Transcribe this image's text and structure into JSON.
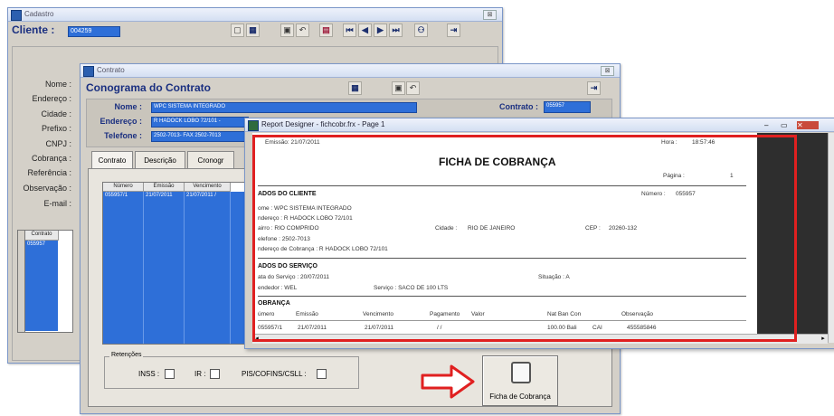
{
  "cadastro": {
    "title": "Cadastro",
    "cliente_label": "Cliente :",
    "cliente_value": "004259",
    "field_labels": [
      "Nome :",
      "Endereço :",
      "Cidade :",
      "Prefixo :",
      "CNPJ :",
      "Cobrança :",
      "Referência :",
      "Observação :",
      "E-mail :"
    ],
    "mini_grid": {
      "header": "Contrato",
      "row": "055957"
    },
    "toolbar_icons": [
      "new-icon",
      "print-icon",
      "save-icon",
      "undo-icon",
      "exit-icon",
      "first-icon",
      "prev-icon",
      "next-icon",
      "last-icon",
      "binoculars-icon",
      "door-exit-icon"
    ]
  },
  "contrato": {
    "title": "Contrato",
    "heading": "Conograma do Contrato",
    "nome_label": "Nome :",
    "nome_value": "WPC SISTEMA INTEGRADO",
    "endereco_label": "Endereço :",
    "endereco_value": "R HADOCK LOBO 72/101 -",
    "telefone_label": "Telefone :",
    "telefone_value": "2502-7013- FAX 2502-7013",
    "contrato_label": "Contrato :",
    "contrato_value": "055957",
    "tabs": [
      "Contrato",
      "Descrição",
      "Cronogr"
    ],
    "grid_headers": [
      "Número",
      "Emissão",
      "Vencimento"
    ],
    "grid_row": [
      "055957/1",
      "21/07/2011",
      "21/07/2011 /"
    ],
    "retencoes_label": "Retenções",
    "inss_label": "INSS :",
    "ir_label": "IR :",
    "pis_label": "PIS/COFINS/CSLL :",
    "ficha_button": "Ficha de Cobrança"
  },
  "report": {
    "title": "Report Designer - fichcobr.frx - Page 1",
    "emissao": "Emissão: 21/07/2011",
    "hora_label": "Hora :",
    "hora_value": "18:57:46",
    "heading": "FICHA DE COBRANÇA",
    "pagina_label": "Página :",
    "pagina_value": "1",
    "dados_cliente": "ADOS DO CLIENTE",
    "numero_label": "Número :",
    "numero_value": "055957",
    "nome": "ome : WPC SISTEMA INTEGRADO",
    "endereco": "ndereço : R HADOCK LOBO 72/101",
    "bairro": "airro : RIO COMPRIDO",
    "cidade_label": "Cidade :",
    "cidade_value": "RIO DE JANEIRO",
    "cep_label": "CEP :",
    "cep_value": "20260-132",
    "telefone": "elefone : 2502-7013",
    "end_cobranca": "ndereço de Cobrança : R HADOCK LOBO 72/101",
    "dados_servico": "ADOS DO SERVIÇO",
    "data_servico": "ata do Serviço : 20/07/2011",
    "situacao": "Situação : A",
    "vendedor": "endedor : WEL",
    "servico": "Serviço : SACO DE 100 LTS",
    "cobranca": "OBRANÇA",
    "cols": [
      "úmero",
      "Emissão",
      "Vencimento",
      "Pagamento",
      "Valor",
      "Nat Ban Con",
      "Observação"
    ],
    "row": [
      "055957/1",
      "21/07/2011",
      "21/07/2011",
      "/ /",
      "",
      "100.00 Bali",
      "CAI",
      "455585846"
    ]
  },
  "accent": {
    "red_frame": "#e02020",
    "arrow": "#e02020",
    "selection_blue": "#2e6fd8"
  }
}
